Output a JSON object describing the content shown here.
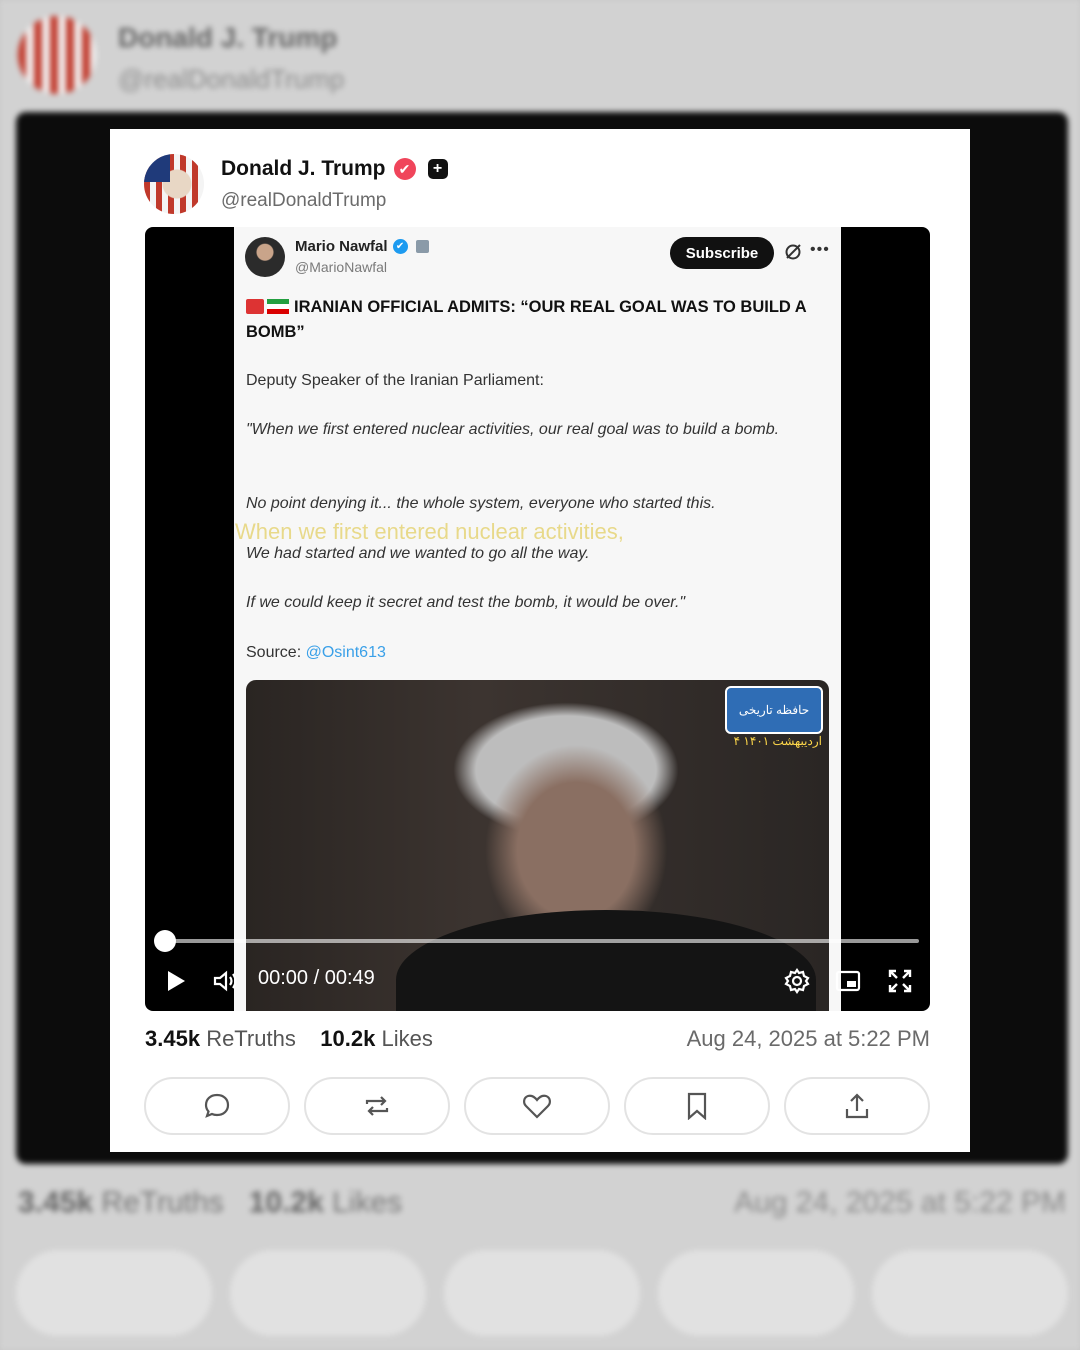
{
  "post": {
    "author_name": "Donald J. Trump",
    "author_handle": "@realDonaldTrump",
    "retruths_count": "3.45k",
    "retruths_label": "ReTruths",
    "likes_count": "10.2k",
    "likes_label": "Likes",
    "date": "Aug 24, 2025 at 5:22 PM"
  },
  "embedded_post": {
    "author_name": "Mario Nawfal",
    "author_handle": "@MarioNawfal",
    "subscribe_label": "Subscribe",
    "headline": "IRANIAN OFFICIAL ADMITS: “OUR REAL GOAL WAS TO BUILD A BOMB”",
    "paragraphs": [
      "Deputy Speaker of the Iranian Parliament:",
      "\"When we first entered nuclear activities, our real goal was to build a bomb.",
      "No point denying it... the whole system, everyone who started this.",
      "We had started and we wanted to go all the way.",
      "If we could keep it secret and test the bomb, it would be over.\""
    ],
    "source_label": "Source:",
    "source_link": "@Osint613"
  },
  "video": {
    "time_display": "00:00 / 00:49",
    "progress": 0,
    "subtitle": "When we first entered nuclear activities,",
    "logo_text": "حافظه تاریخی",
    "logo_date": "۴ اردیبهشت ۱۴۰۱"
  },
  "colors": {
    "verified_badge": "#f0455b",
    "link": "#3aa0e8",
    "blue_check": "#1d9bf0"
  }
}
